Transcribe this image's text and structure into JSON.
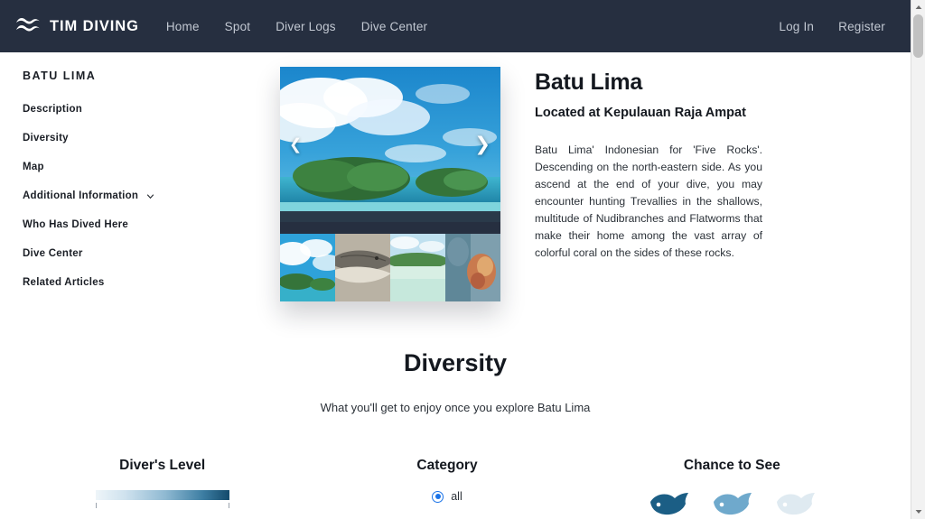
{
  "navbar": {
    "logo_icon": "wave-logo-icon",
    "brand": "TIM DIVING",
    "links": [
      {
        "label": "Home"
      },
      {
        "label": "Spot"
      },
      {
        "label": "Diver Logs"
      },
      {
        "label": "Dive Center"
      }
    ],
    "auth": [
      {
        "label": "Log In"
      },
      {
        "label": "Register"
      }
    ],
    "bg_color": "#262f40",
    "link_color": "#c2c8d2"
  },
  "sidebar": {
    "title": "BATU LIMA",
    "items": [
      {
        "label": "Description",
        "expandable": false
      },
      {
        "label": "Diversity",
        "expandable": false
      },
      {
        "label": "Map",
        "expandable": false
      },
      {
        "label": "Additional Information",
        "expandable": true
      },
      {
        "label": "Who Has Dived Here",
        "expandable": false
      },
      {
        "label": "Dive Center",
        "expandable": false
      },
      {
        "label": "Related Articles",
        "expandable": false
      }
    ]
  },
  "gallery": {
    "prev_icon": "chevron-left-icon",
    "next_icon": "chevron-right-icon",
    "prev_glyph": "❮",
    "next_glyph": "❯",
    "thumbnails": [
      {
        "name": "island-thumbnail"
      },
      {
        "name": "fish-thumbnail"
      },
      {
        "name": "shallow-reef-thumbnail"
      },
      {
        "name": "diver-coral-thumbnail"
      }
    ]
  },
  "spot": {
    "title": "Batu Lima",
    "subtitle": "Located at Kepulauan Raja Ampat",
    "description": "Batu Lima' Indonesian for 'Five Rocks'. Descending on the north-eastern side. As you ascend at the end of your dive, you may encounter hunting Trevallies in the shallows, multitude of Nudibranches and Flatworms that make their home among the vast array of colorful coral on the sides of these rocks."
  },
  "diversity": {
    "title": "Diversity",
    "subtitle": "What you'll get to enjoy once you explore Batu Lima",
    "columns": {
      "divers_level": {
        "heading": "Diver's Level",
        "gradient_from": "#eef5f9",
        "gradient_to": "#134a6b"
      },
      "category": {
        "heading": "Category",
        "options": [
          {
            "label": "all",
            "selected": true
          }
        ],
        "accent_color": "#1a73e8"
      },
      "chance_to_see": {
        "heading": "Chance to See",
        "icons": [
          {
            "name": "fish-icon-high",
            "color": "#1b5e85"
          },
          {
            "name": "fish-icon-medium",
            "color": "#6fa9cc"
          },
          {
            "name": "fish-icon-low",
            "color": "#cfe0ea"
          }
        ]
      }
    }
  },
  "scrollbar": {
    "up_icon": "scroll-up-arrow-icon",
    "down_icon": "scroll-down-arrow-icon"
  }
}
